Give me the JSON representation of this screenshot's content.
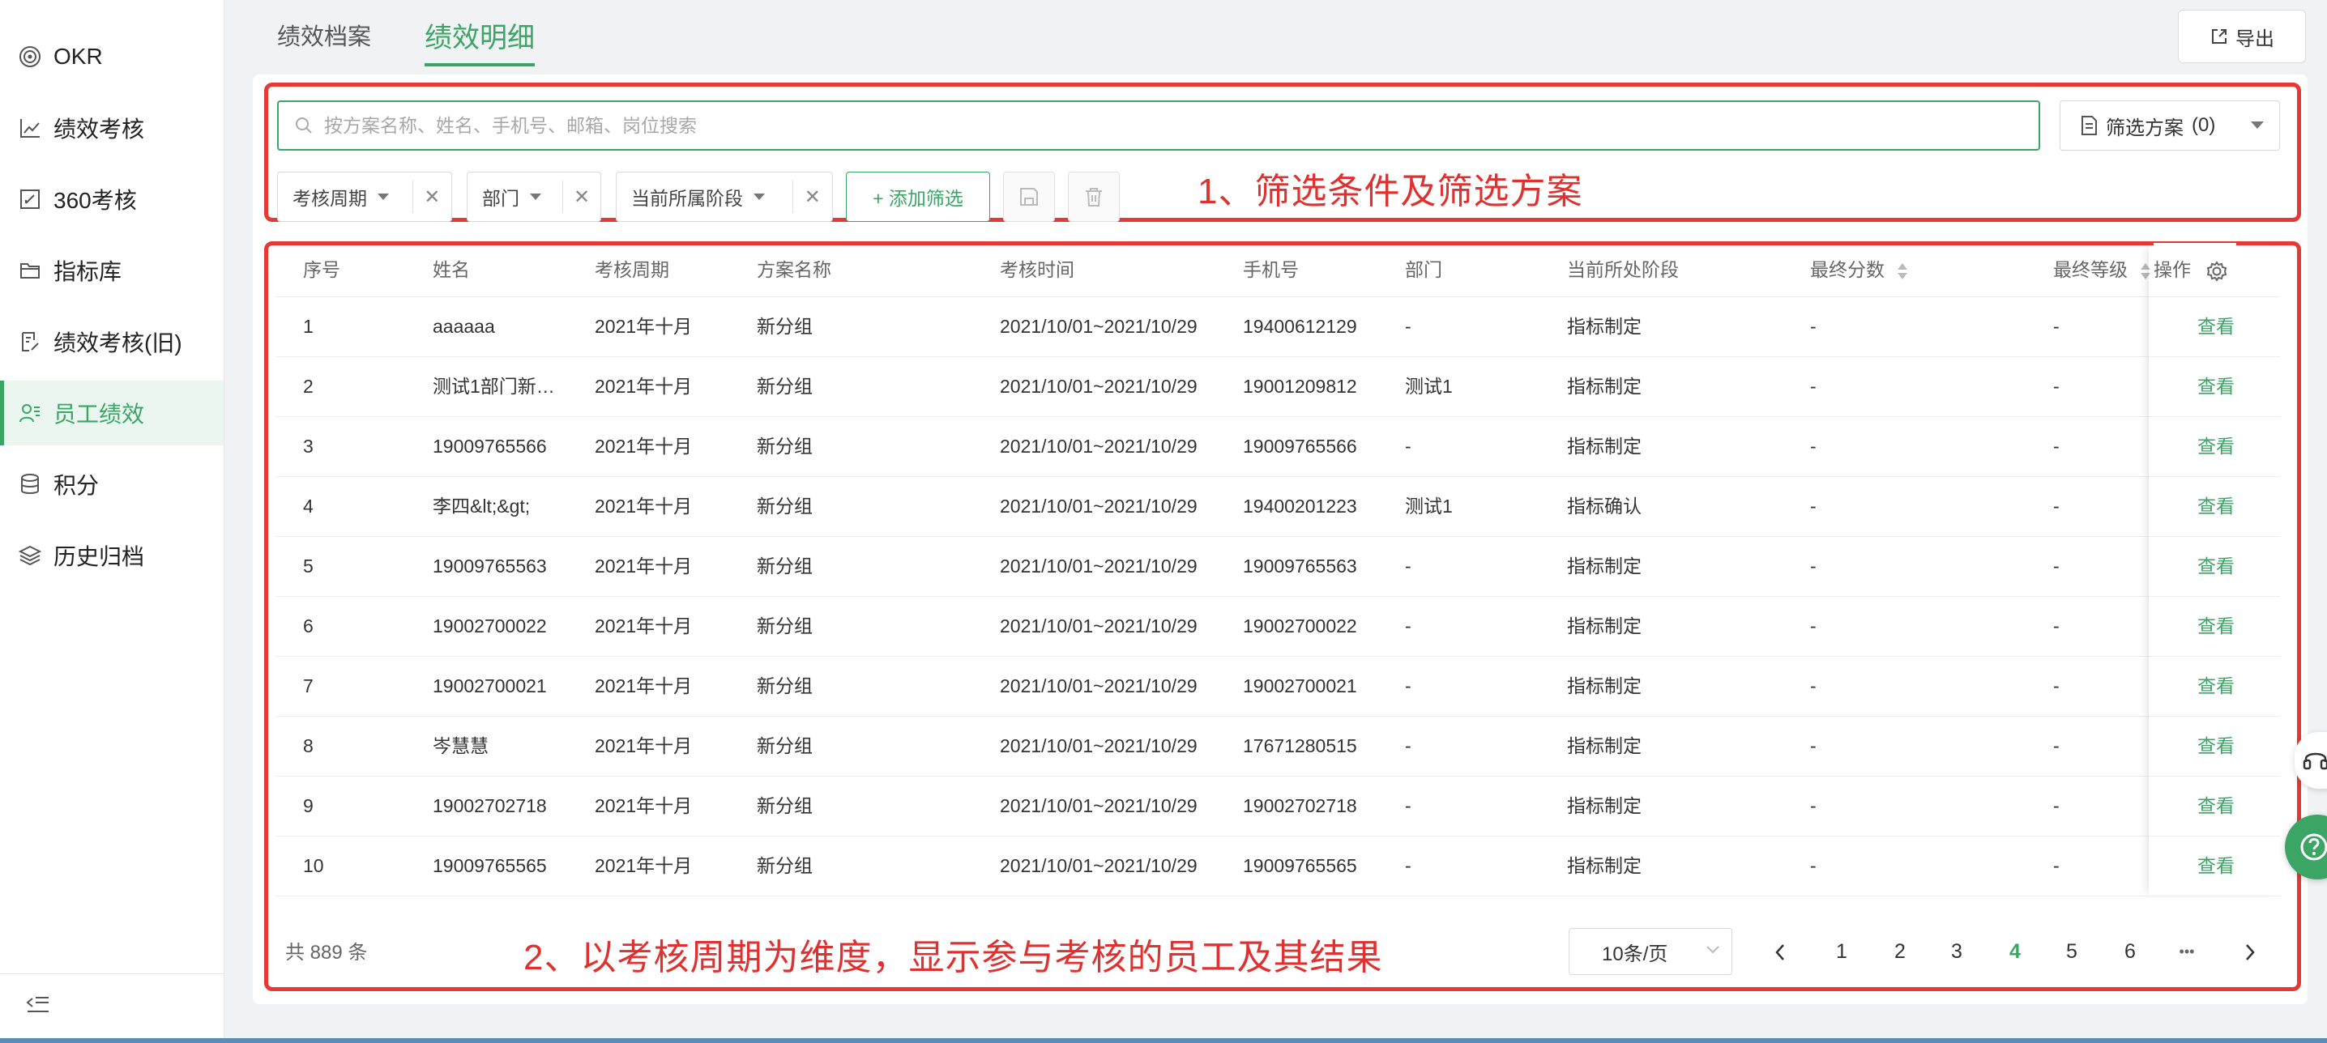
{
  "sidebar": {
    "items": [
      {
        "label": "OKR",
        "icon": "target-icon",
        "active": false
      },
      {
        "label": "绩效考核",
        "icon": "line-chart-icon",
        "active": false
      },
      {
        "label": "360考核",
        "icon": "edit-square-icon",
        "active": false
      },
      {
        "label": "指标库",
        "icon": "folder-icon",
        "active": false
      },
      {
        "label": "绩效考核(旧)",
        "icon": "document-edit-icon",
        "active": false
      },
      {
        "label": "员工绩效",
        "icon": "user-group-icon",
        "active": true
      },
      {
        "label": "积分",
        "icon": "database-icon",
        "active": false
      },
      {
        "label": "历史归档",
        "icon": "layers-icon",
        "active": false
      }
    ],
    "collapse_icon": "collapse-menu-icon"
  },
  "header": {
    "tabs": [
      {
        "label": "绩效档案",
        "active": false
      },
      {
        "label": "绩效明细",
        "active": true
      }
    ],
    "export_label": "导出"
  },
  "filters": {
    "search_placeholder": "按方案名称、姓名、手机号、邮箱、岗位搜索",
    "search_value": "",
    "scheme_label": "筛选方案",
    "scheme_count": "(0)",
    "chips": [
      {
        "label": "考核周期"
      },
      {
        "label": "部门"
      },
      {
        "label": "当前所属阶段"
      }
    ],
    "add_filter_label": "+ 添加筛选"
  },
  "annotations": {
    "note1": "1、筛选条件及筛选方案",
    "note2": "2、以考核周期为维度，显示参与考核的员工及其结果",
    "color": "#e03131"
  },
  "table": {
    "headers": {
      "seq": "序号",
      "name": "姓名",
      "cycle": "考核周期",
      "plan": "方案名称",
      "time": "考核时间",
      "phone": "手机号",
      "dept": "部门",
      "stage": "当前所处阶段",
      "score": "最终分数",
      "grade": "最终等级",
      "action": "操作"
    },
    "rows": [
      {
        "seq": "1",
        "name": "aaaaaa",
        "cycle": "2021年十月",
        "plan": "新分组",
        "time": "2021/10/01~2021/10/29",
        "phone": "19400612129",
        "dept": "-",
        "stage": "指标制定",
        "score": "-",
        "grade": "-",
        "action": "查看"
      },
      {
        "seq": "2",
        "name": "测试1部门新…",
        "cycle": "2021年十月",
        "plan": "新分组",
        "time": "2021/10/01~2021/10/29",
        "phone": "19001209812",
        "dept": "测试1",
        "stage": "指标制定",
        "score": "-",
        "grade": "-",
        "action": "查看"
      },
      {
        "seq": "3",
        "name": "19009765566",
        "cycle": "2021年十月",
        "plan": "新分组",
        "time": "2021/10/01~2021/10/29",
        "phone": "19009765566",
        "dept": "-",
        "stage": "指标制定",
        "score": "-",
        "grade": "-",
        "action": "查看"
      },
      {
        "seq": "4",
        "name": "李四&lt;&gt;",
        "cycle": "2021年十月",
        "plan": "新分组",
        "time": "2021/10/01~2021/10/29",
        "phone": "19400201223",
        "dept": "测试1",
        "stage": "指标确认",
        "score": "-",
        "grade": "-",
        "action": "查看"
      },
      {
        "seq": "5",
        "name": "19009765563",
        "cycle": "2021年十月",
        "plan": "新分组",
        "time": "2021/10/01~2021/10/29",
        "phone": "19009765563",
        "dept": "-",
        "stage": "指标制定",
        "score": "-",
        "grade": "-",
        "action": "查看"
      },
      {
        "seq": "6",
        "name": "19002700022",
        "cycle": "2021年十月",
        "plan": "新分组",
        "time": "2021/10/01~2021/10/29",
        "phone": "19002700022",
        "dept": "-",
        "stage": "指标制定",
        "score": "-",
        "grade": "-",
        "action": "查看"
      },
      {
        "seq": "7",
        "name": "19002700021",
        "cycle": "2021年十月",
        "plan": "新分组",
        "time": "2021/10/01~2021/10/29",
        "phone": "19002700021",
        "dept": "-",
        "stage": "指标制定",
        "score": "-",
        "grade": "-",
        "action": "查看"
      },
      {
        "seq": "8",
        "name": "岑慧慧",
        "cycle": "2021年十月",
        "plan": "新分组",
        "time": "2021/10/01~2021/10/29",
        "phone": "17671280515",
        "dept": "-",
        "stage": "指标制定",
        "score": "-",
        "grade": "-",
        "action": "查看"
      },
      {
        "seq": "9",
        "name": "19002702718",
        "cycle": "2021年十月",
        "plan": "新分组",
        "time": "2021/10/01~2021/10/29",
        "phone": "19002702718",
        "dept": "-",
        "stage": "指标制定",
        "score": "-",
        "grade": "-",
        "action": "查看"
      },
      {
        "seq": "10",
        "name": "19009765565",
        "cycle": "2021年十月",
        "plan": "新分组",
        "time": "2021/10/01~2021/10/29",
        "phone": "19009765565",
        "dept": "-",
        "stage": "指标制定",
        "score": "-",
        "grade": "-",
        "action": "查看"
      }
    ]
  },
  "pagination": {
    "total": "共 889 条",
    "page_size": "10条/页",
    "pages": [
      "1",
      "2",
      "3",
      "4",
      "5",
      "6"
    ],
    "current": "4",
    "ellipsis": "•••"
  },
  "colors": {
    "accent": "#3aa565",
    "annotation_red": "#e53935"
  }
}
